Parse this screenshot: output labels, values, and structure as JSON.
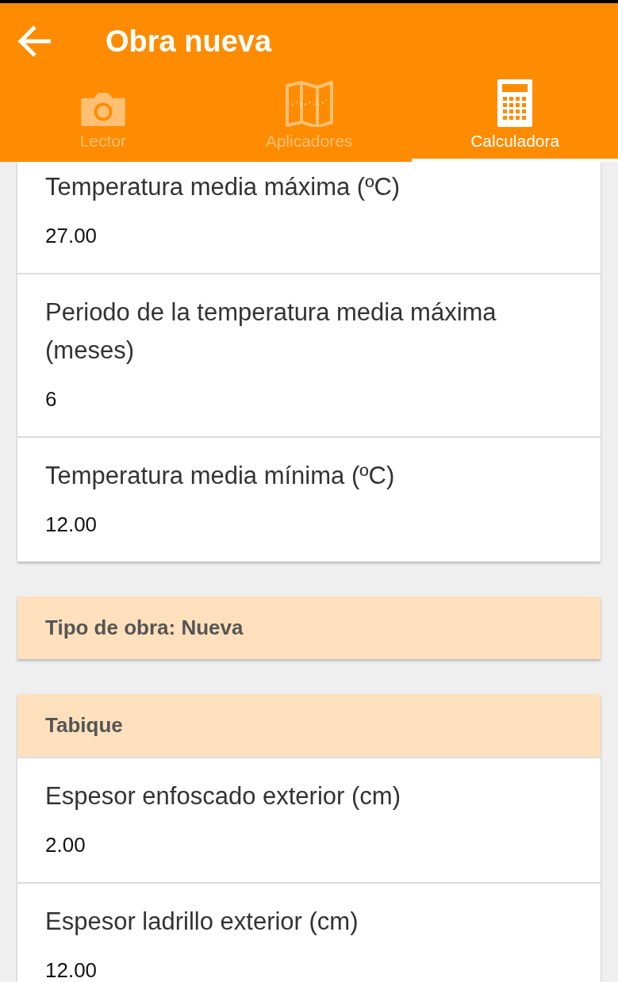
{
  "app_bar": {
    "title": "Obra nueva"
  },
  "tabs": [
    {
      "label": "Lector",
      "kind": "camera",
      "selected": false
    },
    {
      "label": "Aplicadores",
      "kind": "map",
      "selected": false
    },
    {
      "label": "Calculadora",
      "kind": "calculator",
      "selected": true
    }
  ],
  "sections": [
    {
      "kind": "fields",
      "items": [
        {
          "label": "Temperatura media máxima (ºC)",
          "value": "27.00"
        },
        {
          "label": "Periodo de la temperatura media máxima (meses)",
          "value": "6"
        },
        {
          "label": "Temperatura media mínima (ºC)",
          "value": "12.00"
        }
      ]
    },
    {
      "kind": "banner",
      "title": "Tipo de obra: Nueva"
    },
    {
      "kind": "group",
      "title": "Tabique",
      "items": [
        {
          "label": "Espesor enfoscado exterior (cm)",
          "value": "2.00"
        },
        {
          "label": "Espesor ladrillo exterior (cm)",
          "value": "12.00"
        }
      ]
    }
  ]
}
